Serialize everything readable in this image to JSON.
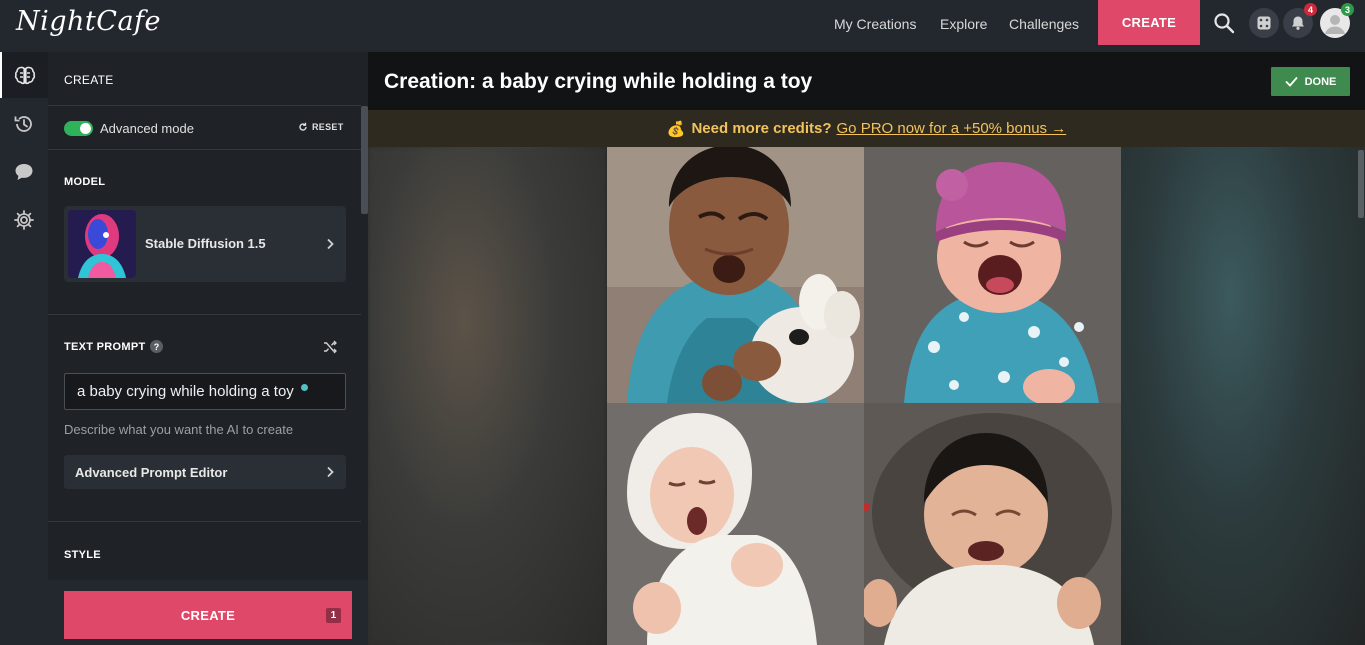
{
  "brand": {
    "logo": "NightCafe"
  },
  "nav": {
    "links": [
      "My Creations",
      "Explore",
      "Challenges"
    ],
    "create_label": "CREATE",
    "notifications_count": "4",
    "profile_count": "3"
  },
  "sidebar": {
    "header": "CREATE",
    "advanced_mode_label": "Advanced mode",
    "advanced_mode_on": true,
    "reset_label": "RESET",
    "model_section": "MODEL",
    "model_name": "Stable Diffusion 1.5",
    "text_prompt_section": "TEXT PROMPT",
    "prompt_value": "a baby crying while holding a toy",
    "prompt_hint": "Describe what you want the AI to create",
    "advanced_prompt_editor": "Advanced Prompt Editor",
    "style_section": "STYLE",
    "create_button": "CREATE",
    "create_count": "1"
  },
  "main": {
    "title": "Creation: a baby crying while holding a toy",
    "done_label": "DONE",
    "credits_icon": "💰",
    "credits_bold": "Need more credits?",
    "credits_link": "Go PRO now for a +50% bonus →"
  },
  "colors": {
    "accent": "#e0486a",
    "success": "#3f8a4e",
    "credits": "#f2c35c"
  }
}
